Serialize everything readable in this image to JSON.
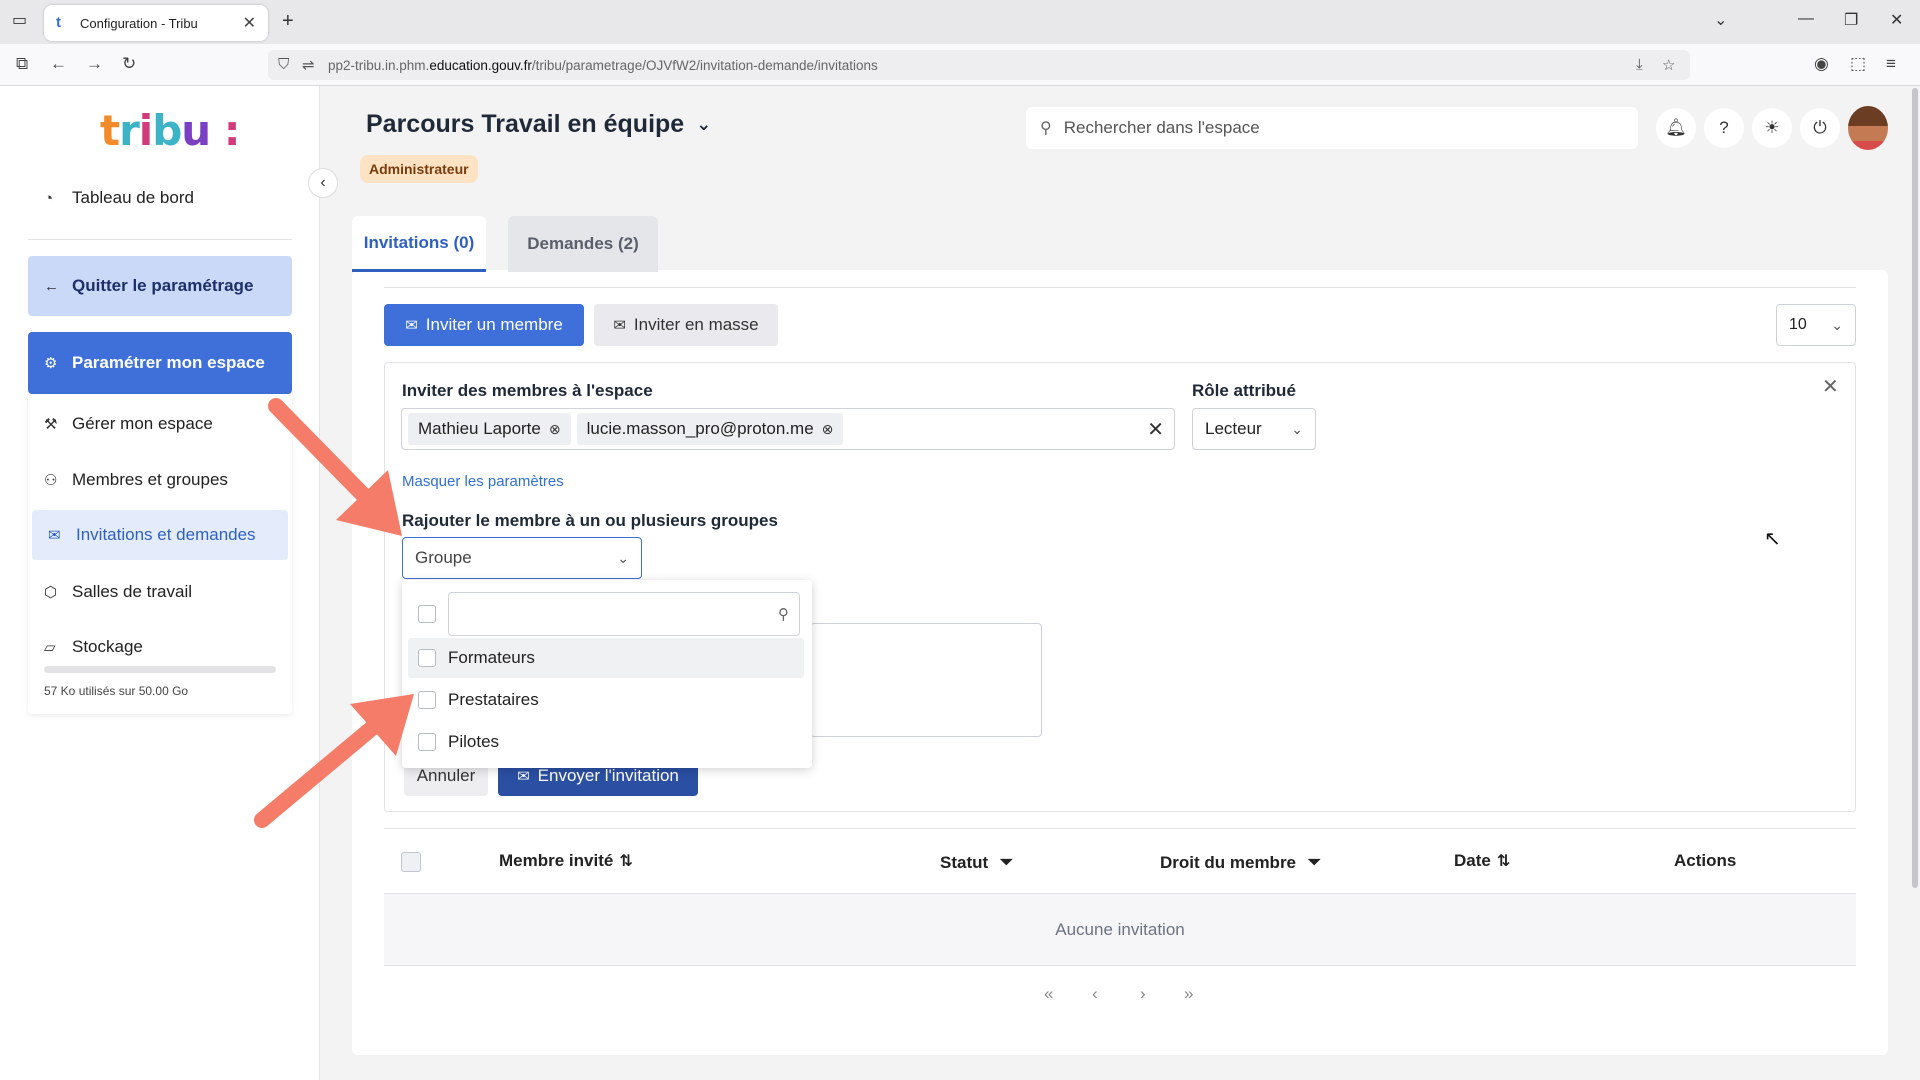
{
  "browser": {
    "tab_title": "Configuration - Tribu",
    "url_prefix": "pp2-tribu.in.phm.",
    "url_domain": "education.gouv.fr",
    "url_path": "/tribu/parametrage/OJVfW2/invitation-demande/invitations"
  },
  "sidebar": {
    "dashboard": "Tableau de bord",
    "quit": "Quitter le paramétrage",
    "param": "Paramétrer mon espace",
    "items": [
      {
        "label": "Gérer mon espace"
      },
      {
        "label": "Membres et groupes"
      },
      {
        "label": "Invitations et demandes"
      },
      {
        "label": "Salles de travail"
      },
      {
        "label": "Stockage"
      }
    ],
    "storage_usage": "57 Ko utilisés sur 50.00 Go"
  },
  "header": {
    "space_title": "Parcours Travail en équipe",
    "role_badge": "Administrateur",
    "search_placeholder": "Rechercher dans l'espace"
  },
  "tabs": {
    "invitations": "Invitations (0)",
    "requests": "Demandes (2)"
  },
  "toolbar": {
    "invite_member": "Inviter un membre",
    "invite_bulk": "Inviter en masse",
    "per_page": "10"
  },
  "invite_form": {
    "members_label": "Inviter des membres à l'espace",
    "chips": [
      "Mathieu Laporte",
      "lucie.masson_pro@proton.me"
    ],
    "role_label": "Rôle attribué",
    "role_value": "Lecteur",
    "hide_params": "Masquer les paramètres",
    "groups_label": "Rajouter le membre à un ou plusieurs groupes",
    "group_placeholder": "Groupe",
    "group_options": [
      "Formateurs",
      "Prestataires",
      "Pilotes"
    ],
    "cancel": "Annuler",
    "send": "Envoyer l'invitation"
  },
  "table": {
    "col_member": "Membre invité",
    "col_status": "Statut",
    "col_right": "Droit du membre",
    "col_date": "Date",
    "col_actions": "Actions",
    "empty": "Aucune invitation"
  },
  "colors": {
    "primary": "#3f6fd8",
    "annotation_arrow": "#f47c68"
  }
}
